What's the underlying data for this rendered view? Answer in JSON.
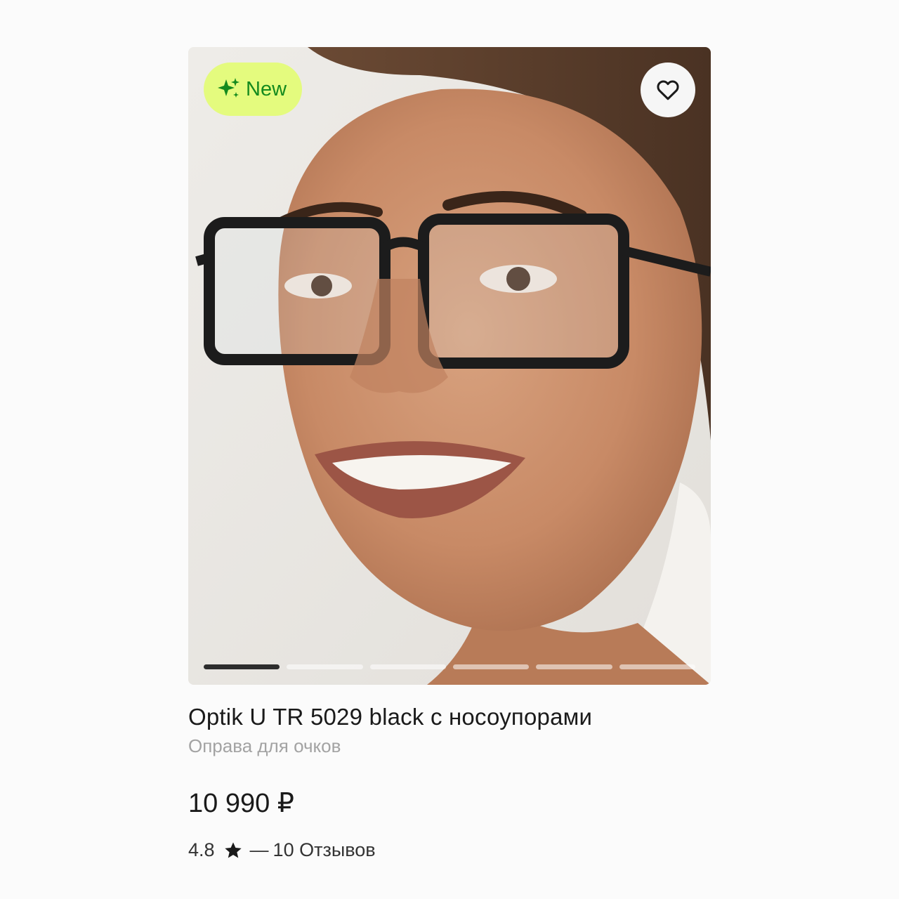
{
  "product": {
    "badge_label": "New",
    "badge_icon": "sparkle-icon",
    "favorite_icon": "heart-icon",
    "title": "Optik U TR 5029 black с носоупорами",
    "subtitle": "Оправа для очков",
    "price": "10 990 ₽",
    "rating": "4.8",
    "rating_icon": "star-icon",
    "reviews": "10 Отзывов",
    "reviews_separator": "—",
    "gallery": {
      "total_images": 6,
      "active_index": 0
    }
  },
  "colors": {
    "badge_bg": "#e4fb7e",
    "badge_text": "#148a1e",
    "text_primary": "#1a1a1a",
    "text_secondary": "#a3a3a3"
  }
}
